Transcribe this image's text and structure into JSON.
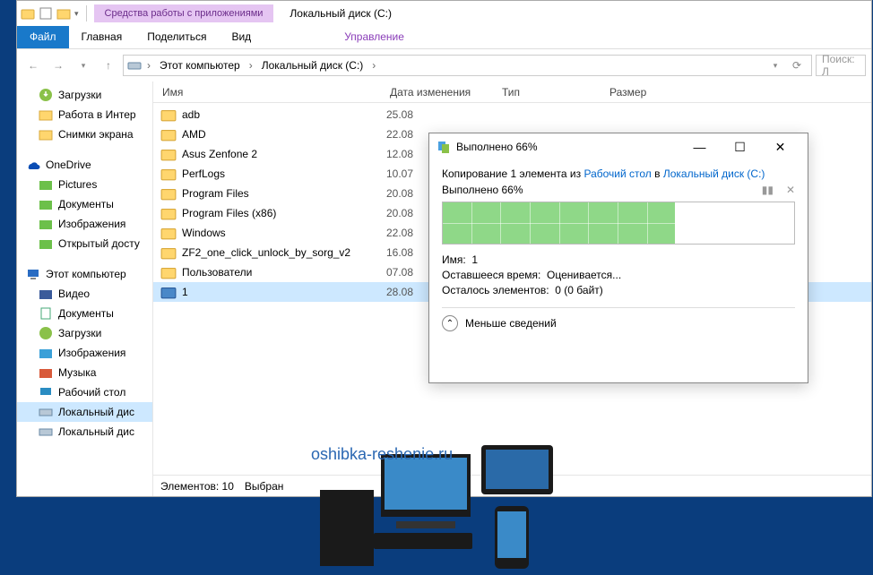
{
  "titlebar": {
    "context_tab": "Средства работы с приложениями",
    "window_title": "Локальный диск (C:)"
  },
  "ribbon": {
    "file": "Файл",
    "home": "Главная",
    "share": "Поделиться",
    "view": "Вид",
    "manage": "Управление"
  },
  "address": {
    "crumb1": "Этот компьютер",
    "crumb2": "Локальный диск (C:)"
  },
  "search": {
    "placeholder": "Поиск: Л"
  },
  "sidebar": {
    "quick": [
      {
        "label": "Загрузки",
        "icon": "downloads"
      },
      {
        "label": "Работа в Интер",
        "icon": "folder-pin"
      },
      {
        "label": "Снимки экрана",
        "icon": "folder-pin"
      }
    ],
    "onedrive_label": "OneDrive",
    "onedrive": [
      {
        "label": "Pictures",
        "icon": "folder"
      },
      {
        "label": "Документы",
        "icon": "folder"
      },
      {
        "label": "Изображения",
        "icon": "folder"
      },
      {
        "label": "Открытый досту",
        "icon": "folder"
      }
    ],
    "thispc_label": "Этот компьютер",
    "thispc": [
      {
        "label": "Видео",
        "icon": "video"
      },
      {
        "label": "Документы",
        "icon": "docs"
      },
      {
        "label": "Загрузки",
        "icon": "downloads"
      },
      {
        "label": "Изображения",
        "icon": "pictures"
      },
      {
        "label": "Музыка",
        "icon": "music"
      },
      {
        "label": "Рабочий стол",
        "icon": "desktop"
      },
      {
        "label": "Локальный дис",
        "icon": "disk",
        "selected": true
      },
      {
        "label": "Локальный дис",
        "icon": "disk"
      }
    ]
  },
  "columns": {
    "name": "Имя",
    "date": "Дата изменения",
    "type": "Тип",
    "size": "Размер"
  },
  "files": [
    {
      "name": "adb",
      "date": "25.08",
      "icon": "folder"
    },
    {
      "name": "AMD",
      "date": "22.08",
      "icon": "folder"
    },
    {
      "name": "Asus Zenfone 2",
      "date": "12.08",
      "icon": "folder"
    },
    {
      "name": "PerfLogs",
      "date": "10.07",
      "icon": "folder"
    },
    {
      "name": "Program Files",
      "date": "20.08",
      "icon": "folder"
    },
    {
      "name": "Program Files (x86)",
      "date": "20.08",
      "icon": "folder"
    },
    {
      "name": "Windows",
      "date": "22.08",
      "icon": "folder"
    },
    {
      "name": "ZF2_one_click_unlock_by_sorg_v2",
      "date": "16.08",
      "icon": "folder"
    },
    {
      "name": "Пользователи",
      "date": "07.08",
      "icon": "folder"
    },
    {
      "name": "1",
      "date": "28.08",
      "icon": "app",
      "selected": true
    }
  ],
  "statusbar": {
    "count_label": "Элементов:",
    "count": "10",
    "sel_label": "Выбран"
  },
  "watermark": "oshibka-reshenie.ru",
  "dialog": {
    "title": "Выполнено 66%",
    "desc_pre": "Копирование 1 элемента из ",
    "desc_src": "Рабочий стол",
    "desc_mid": " в ",
    "desc_dst": "Локальный диск (C:)",
    "progress_label": "Выполнено 66%",
    "progress_pct": 66,
    "info_name_label": "Имя:",
    "info_name": "1",
    "info_time_label": "Оставшееся время:",
    "info_time": "Оценивается...",
    "info_remain_label": "Осталось элементов:",
    "info_remain": "0 (0 байт)",
    "toggle": "Меньше сведений"
  }
}
